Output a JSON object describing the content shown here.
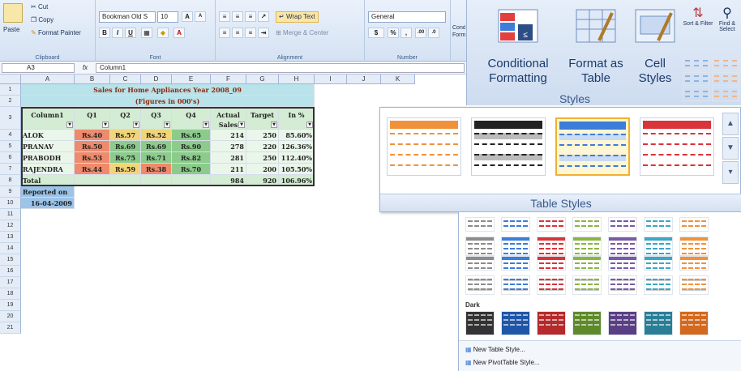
{
  "ribbon": {
    "clipboard": {
      "paste": "Paste",
      "cut": "Cut",
      "copy": "Copy",
      "format_painter": "Format Painter",
      "label": "Clipboard"
    },
    "font": {
      "name": "Bookman Old S",
      "size": "10",
      "bold": "B",
      "italic": "I",
      "underline": "U",
      "label": "Font",
      "grow": "A",
      "shrink": "A"
    },
    "alignment": {
      "wrap_text": "Wrap Text",
      "merge_center": "Merge & Center",
      "label": "Alignment"
    },
    "number": {
      "format": "General",
      "percent": "%",
      "comma": ",",
      "inc_dec": ".00",
      "dec_dec": ".0",
      "label": "Number",
      "currency": "$"
    },
    "cond_partial": "Cond Form"
  },
  "formula_bar": {
    "cell_ref": "A3",
    "fx": "fx",
    "content": "Column1"
  },
  "columns": [
    "A",
    "B",
    "C",
    "D",
    "E",
    "F",
    "G",
    "H",
    "I",
    "J",
    "K"
  ],
  "row_numbers": [
    "1",
    "2",
    "3",
    "4",
    "5",
    "6",
    "7",
    "8",
    "9",
    "10",
    "11",
    "12",
    "13",
    "14",
    "15",
    "16",
    "17",
    "18",
    "19",
    "20",
    "21"
  ],
  "sheet": {
    "title1": "Sales for Home Appliances Year 2008_09",
    "title2": "(Figures in 000's)",
    "headers": [
      "Column1",
      "Q1",
      "Q2",
      "Q3",
      "Q4",
      "Actual Sales",
      "Target",
      "In %"
    ],
    "rows": [
      [
        "ALOK",
        "Rs.40",
        "Rs.57",
        "Rs.52",
        "Rs.65",
        "214",
        "250",
        "85.60%"
      ],
      [
        "PRANAV",
        "Rs.50",
        "Rs.69",
        "Rs.69",
        "Rs.90",
        "278",
        "220",
        "126.36%"
      ],
      [
        "PRABODH",
        "Rs.53",
        "Rs.75",
        "Rs.71",
        "Rs.82",
        "281",
        "250",
        "112.40%"
      ],
      [
        "RAJENDRA",
        "Rs.44",
        "Rs.59",
        "Rs.38",
        "Rs.70",
        "211",
        "200",
        "105.50%"
      ]
    ],
    "total": [
      "Total",
      "",
      "",
      "",
      "",
      "984",
      "920",
      "106.96%"
    ],
    "reported_label": "Reported on",
    "reported_date": "16-04-2009"
  },
  "styles_group": {
    "conditional_formatting": "Conditional Formatting",
    "format_as_table": "Format as Table",
    "cell_styles": "Cell Styles",
    "label": "Styles",
    "sort_filter": "Sort & Filter",
    "find_select": "Find & Select"
  },
  "table_styles": {
    "title": "Table Styles",
    "swatch_colors": [
      "#f0923a",
      "#222222",
      "#3b7dd8",
      "#d9343a"
    ],
    "light_colors": [
      "#8c8c8c",
      "#3b7dd8",
      "#d9343a",
      "#8ab542",
      "#7a59a6",
      "#3ba7c4",
      "#f0923a"
    ],
    "dark_label": "Dark",
    "dark_colors": [
      "#333333",
      "#1f56a8",
      "#b52a2a",
      "#5e8a2a",
      "#5a3f85",
      "#2a7e96",
      "#d2691e"
    ],
    "new_table_style": "New Table Style...",
    "new_pivot_style": "New PivotTable Style..."
  }
}
